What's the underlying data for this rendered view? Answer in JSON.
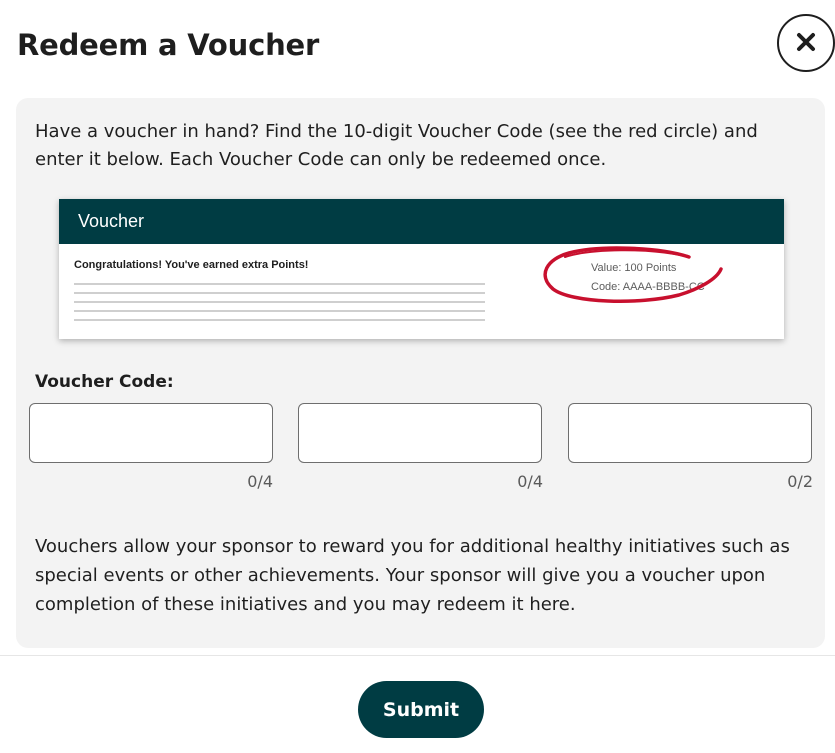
{
  "dialog": {
    "title": "Redeem a Voucher",
    "close_icon": "close-icon"
  },
  "intro_text": "Have a voucher in hand? Find the 10-digit Voucher Code (see the red circle) and enter it below. Each Voucher Code can only be redeemed once.",
  "voucher_example": {
    "header": "Voucher",
    "congrats": "Congratulations! You've earned extra Points!",
    "value_line": "Value: 100 Points",
    "code_line": "Code: AAAA-BBBB-CC",
    "highlight_color": "#c8102e"
  },
  "voucher_code": {
    "label": "Voucher Code:",
    "fields": [
      {
        "value": "",
        "counter": "0/4"
      },
      {
        "value": "",
        "counter": "0/4"
      },
      {
        "value": "",
        "counter": "0/2"
      }
    ]
  },
  "info_text": "Vouchers allow your sponsor to reward you for additional healthy initiatives such as special events or other achievements. Your sponsor will give you a voucher upon completion of these initiatives and you may redeem it here.",
  "footer": {
    "submit_label": "Submit"
  },
  "colors": {
    "brand_dark": "#003c43",
    "panel_bg": "#f3f3f3"
  }
}
